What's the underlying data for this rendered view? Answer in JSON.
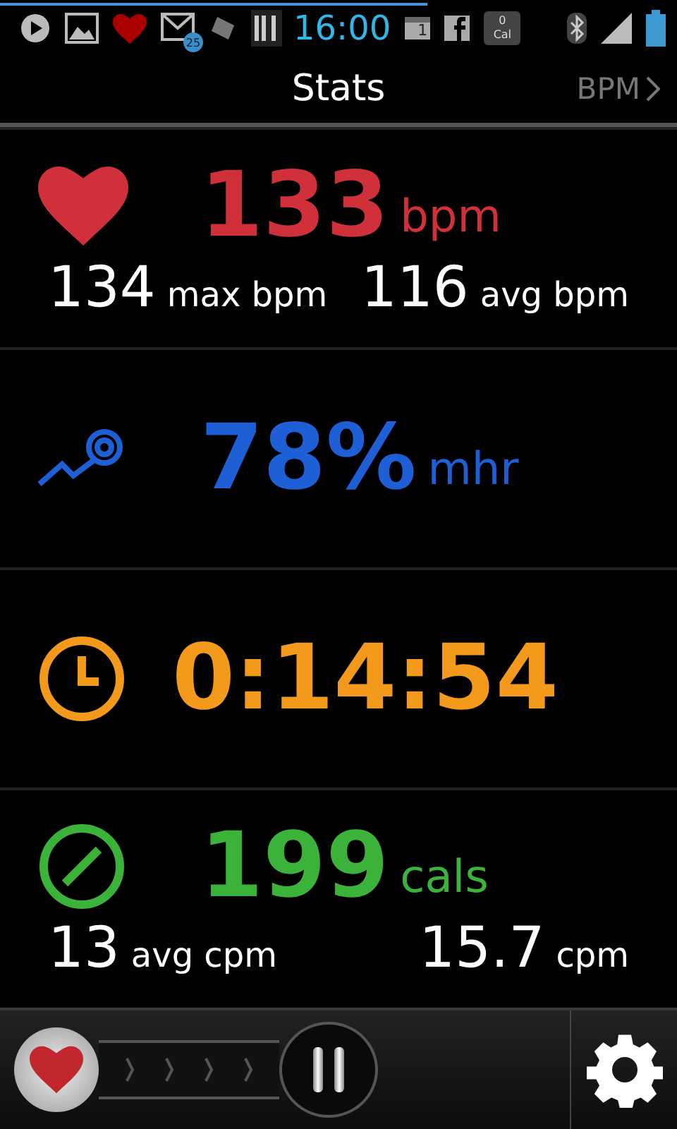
{
  "status_bar": {
    "time": "16:00",
    "mail_badge": "25",
    "calendar_day": "1",
    "cal_count": "0",
    "cal_label": "Cal"
  },
  "header": {
    "title": "Stats",
    "link": "BPM"
  },
  "panels": [
    {
      "kind": "heart",
      "color": "#d0303a",
      "value": "133",
      "unit": "bpm",
      "stats": [
        {
          "value": "134",
          "unit": "max bpm"
        },
        {
          "value": "116",
          "unit": "avg bpm"
        }
      ]
    },
    {
      "kind": "zone",
      "color": "#1f5fd6",
      "value": "78%",
      "unit": "mhr"
    },
    {
      "kind": "timer",
      "color": "#f39a1c",
      "value": "0:14:54"
    },
    {
      "kind": "calories",
      "color": "#3bb33b",
      "value": "199",
      "unit": "cals",
      "stats": [
        {
          "value": "13",
          "unit": "avg cpm"
        },
        {
          "value": "15.7",
          "unit": "cpm"
        }
      ]
    }
  ],
  "slider": {
    "level": 0
  }
}
